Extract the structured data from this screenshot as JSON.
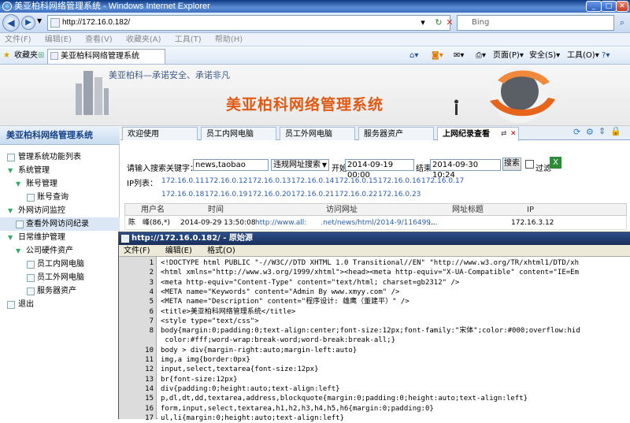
{
  "browser": {
    "title": "美亚柏科网络管理系统 - Windows Internet Explorer",
    "url": "http://172.16.0.182/",
    "search_placeholder": "Bing",
    "menu": [
      "文件(F)",
      "编辑(E)",
      "查看(V)",
      "收藏夹(A)",
      "工具(T)",
      "帮助(H)"
    ],
    "favorites_label": "收藏夹",
    "tab_title": "美亚柏科网络管理系统",
    "commands": {
      "page": "页面(P)",
      "safety": "安全(S)",
      "tools": "工具(O)",
      "help": "?"
    }
  },
  "banner": {
    "slogan": "美亚柏科—承诺安全、承诺非凡",
    "system_title": "美亚柏科网络管理系统"
  },
  "sidebar": {
    "title": "美亚柏科网络管理系统",
    "items": [
      {
        "label": "管理系统功能列表"
      },
      {
        "label": "系统管理"
      },
      {
        "label": "账号管理"
      },
      {
        "label": "账号查询"
      },
      {
        "label": "外网访问监控"
      },
      {
        "label": "查看外网访问纪录"
      },
      {
        "label": "日常维护管理"
      },
      {
        "label": "公司硬件资产"
      },
      {
        "label": "员工内网电脑"
      },
      {
        "label": "员工外网电脑"
      },
      {
        "label": "服务器资产"
      },
      {
        "label": "退出"
      }
    ]
  },
  "tabs": [
    "欢迎使用",
    "员工内网电脑",
    "员工外网电脑",
    "服务器资产",
    "上网纪录查看"
  ],
  "query": {
    "keyword_label": "请输入搜索关键字：",
    "keyword_value": "news,taobao",
    "select_value": "违规网址搜索",
    "start_label": "开始",
    "start_value": "2014-09-19 00:00",
    "end_label": "结束",
    "end_value": "2014-09-30 10:24",
    "search_button": "搜索",
    "filter_label": "过滤",
    "ip_label": "IP列表：",
    "ips": [
      "172.16.0.11",
      "172.16.0.12",
      "172.16.0.13",
      "172.16.0.14",
      "172.16.0.15",
      "172.16.0.16",
      "172.16.0.17",
      "172.16.0.18",
      "172.16.0.19",
      "172.16.0.20",
      "172.16.0.21",
      "172.16.0.22",
      "172.16.0.23"
    ]
  },
  "table": {
    "headers": [
      "用户名",
      "时间",
      "访问网址",
      "网址标题",
      "IP"
    ],
    "row": {
      "user": "陈　峰(86,*)",
      "time": "2014-09-29 13:50:08",
      "url": "http://www.all:　　.net/news/html/2014-9/116499...",
      "title": "...",
      "ip": "172.16.3.12"
    }
  },
  "source": {
    "title": "http://172.16.0.182/ - 原始源",
    "menu": [
      "文件(F)",
      "编辑(E)",
      "格式(O)"
    ],
    "lines": [
      "<!DOCTYPE html PUBLIC \"-//W3C//DTD XHTML 1.0 Transitional//EN\" \"http://www.w3.org/TR/xhtml1/DTD/xh",
      "<html xmlns=\"http://www.w3.org/1999/xhtml\"><head><meta http-equiv=\"X-UA-Compatible\" content=\"IE=Em",
      "<meta http-equiv=\"Content-Type\" content=\"text/html; charset=gb2312\" />",
      "<META name=\"Keywords\" content=\"Admin By www.xmyy.com\" />",
      "<META name=\"Description\" content=\"程序设计: 雄鹰（董建平）\" />",
      "<title>美亚柏科网络管理系统</title>",
      "<style type=\"text/css\">",
      "body{margin:0;padding:0;text-align:center;font-size:12px;font-family:\"宋体\";color:#000;overflow:hid",
      " color:#fff;word-wrap:break-word;word-break:break-all;}",
      "body > div{margin-right:auto;margin-left:auto}",
      "img,a img{border:0px}",
      "input,select,textarea{font-size:12px}",
      "br{font-size:12px}",
      "div{padding:0;height:auto;text-align:left}",
      "p,dl,dt,dd,textarea,address,blockquote{margin:0;padding:0;height:auto;text-align:left}",
      "form,input,select,textarea,h1,h2,h3,h4,h5,h6{margin:0;padding:0}",
      "ul,li{margin:0;height:auto;text-align:left}"
    ],
    "line_numbers": [
      "1",
      "2",
      "3",
      "4",
      "5",
      "6",
      "7",
      "8",
      "",
      "10",
      "11",
      "12",
      "13",
      "14",
      "15",
      "16",
      "17"
    ]
  },
  "colors": {
    "accent": "#e05a14",
    "title_bar": "#2b4e8a",
    "link": "#2a5db0"
  }
}
